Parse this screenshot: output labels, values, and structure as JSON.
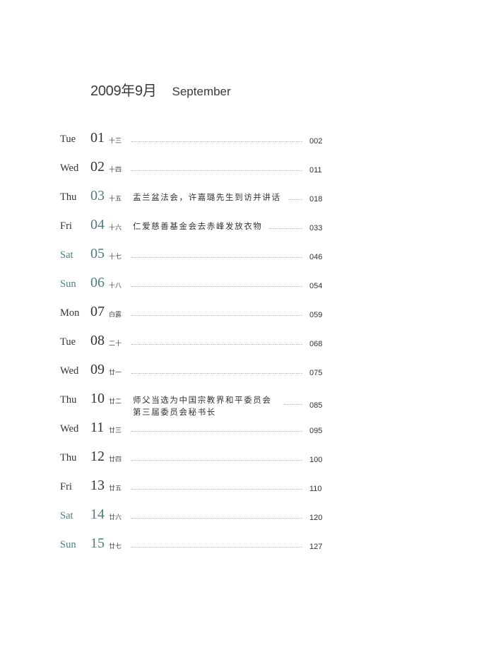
{
  "header": {
    "title_cn": "2009年9月",
    "title_en": "September"
  },
  "days": [
    {
      "dow": "Tue",
      "day": "01",
      "lunar": "十三",
      "event": "",
      "page": "002"
    },
    {
      "dow": "Wed",
      "day": "02",
      "lunar": "十四",
      "event": "",
      "page": "011"
    },
    {
      "dow": "Thu",
      "day": "03",
      "lunar": "十五",
      "event": "盂兰盆法会，许嘉璐先生到访并讲话",
      "page": "018"
    },
    {
      "dow": "Fri",
      "day": "04",
      "lunar": "十六",
      "event": "仁爱慈善基金会去赤峰发放衣物",
      "page": "033"
    },
    {
      "dow": "Sat",
      "day": "05",
      "lunar": "十七",
      "event": "",
      "page": "046"
    },
    {
      "dow": "Sun",
      "day": "06",
      "lunar": "十八",
      "event": "",
      "page": "054"
    },
    {
      "dow": "Mon",
      "day": "07",
      "lunar": "白露",
      "event": "",
      "page": "059"
    },
    {
      "dow": "Tue",
      "day": "08",
      "lunar": "二十",
      "event": "",
      "page": "068"
    },
    {
      "dow": "Wed",
      "day": "09",
      "lunar": "廿一",
      "event": "",
      "page": "075"
    },
    {
      "dow": "Thu",
      "day": "10",
      "lunar": "廿二",
      "event": "师父当选为中国宗教界和平委员会",
      "event2": "第三届委员会秘书长",
      "page": "085"
    },
    {
      "dow": "Wed",
      "day": "11",
      "lunar": "廿三",
      "event": "",
      "page": "095"
    },
    {
      "dow": "Thu",
      "day": "12",
      "lunar": "廿四",
      "event": "",
      "page": "100"
    },
    {
      "dow": "Fri",
      "day": "13",
      "lunar": "廿五",
      "event": "",
      "page": "110"
    },
    {
      "dow": "Sat",
      "day": "14",
      "lunar": "廿六",
      "event": "",
      "page": "120"
    },
    {
      "dow": "Sun",
      "day": "15",
      "lunar": "廿七",
      "event": "",
      "page": "127"
    }
  ]
}
